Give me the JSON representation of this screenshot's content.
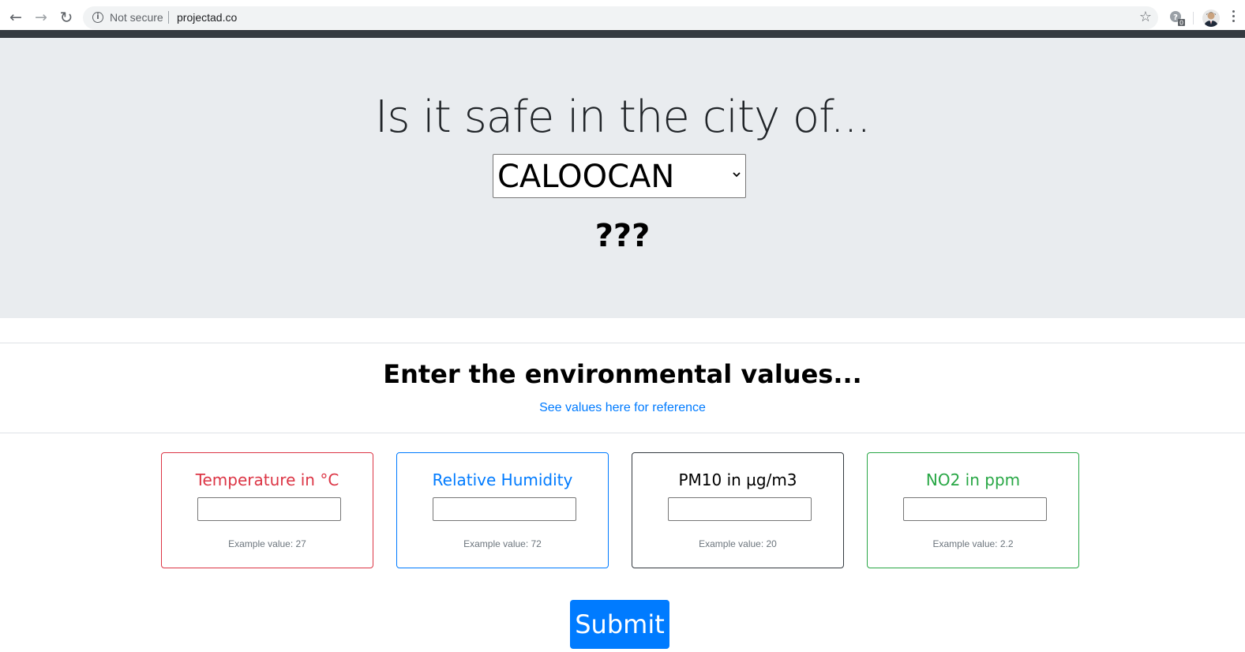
{
  "browser": {
    "back_icon": "arrow-left-icon",
    "forward_icon": "arrow-right-icon",
    "reload_icon": "reload-icon",
    "security_label": "Not secure",
    "url": "projectad.co",
    "bookmark_icon": "star-icon",
    "extension_badge": "0"
  },
  "hero": {
    "title": "Is it safe in the city of...",
    "city_selected": "CALOOCAN",
    "result": "???"
  },
  "section": {
    "title": "Enter the environmental values...",
    "reference_link": "See values here for reference"
  },
  "cards": [
    {
      "title": "Temperature in °C",
      "hint": "Example value: 27",
      "color": "#dc3545"
    },
    {
      "title": "Relative Humidity",
      "hint": "Example value: 72",
      "color": "#007bff"
    },
    {
      "title": "PM10 in µg/m3",
      "hint": "Example value: 20",
      "color": "#343a40"
    },
    {
      "title": "NO2 in ppm",
      "hint": "Example value: 2.2",
      "color": "#28a745"
    }
  ],
  "submit_label": "Submit",
  "colors": {
    "navbar": "#343a40",
    "jumbotron": "#e9ecef",
    "primary": "#007bff"
  }
}
